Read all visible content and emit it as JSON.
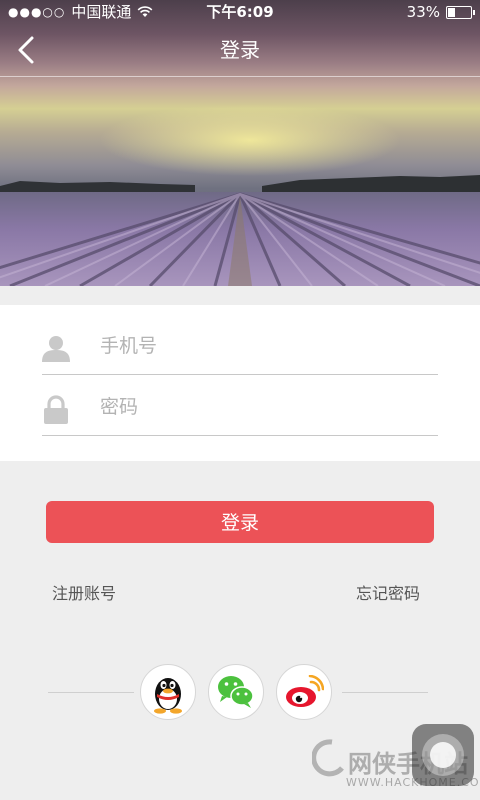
{
  "status_bar": {
    "signal_dots": "●●●○○",
    "carrier": "中国联通",
    "time": "下午6:09",
    "battery_percent": "33%",
    "battery_level": 0.33
  },
  "nav": {
    "title": "登录",
    "back_icon": "chevron-left-icon"
  },
  "form": {
    "phone_placeholder": "手机号",
    "phone_value": "",
    "password_placeholder": "密码",
    "password_value": "",
    "phone_icon": "user-icon",
    "password_icon": "lock-icon"
  },
  "actions": {
    "login_label": "登录",
    "register_label": "注册账号",
    "forgot_label": "忘记密码"
  },
  "social": [
    {
      "name": "qq",
      "icon": "qq-penguin-icon"
    },
    {
      "name": "wechat",
      "icon": "wechat-icon"
    },
    {
      "name": "weibo",
      "icon": "weibo-icon"
    }
  ],
  "watermark": {
    "text": "网侠手机站",
    "url": "WWW.HACKHOME.COM"
  },
  "colors": {
    "accent": "#ec5257",
    "background": "#eeeeee",
    "placeholder": "#b3b3b3"
  }
}
